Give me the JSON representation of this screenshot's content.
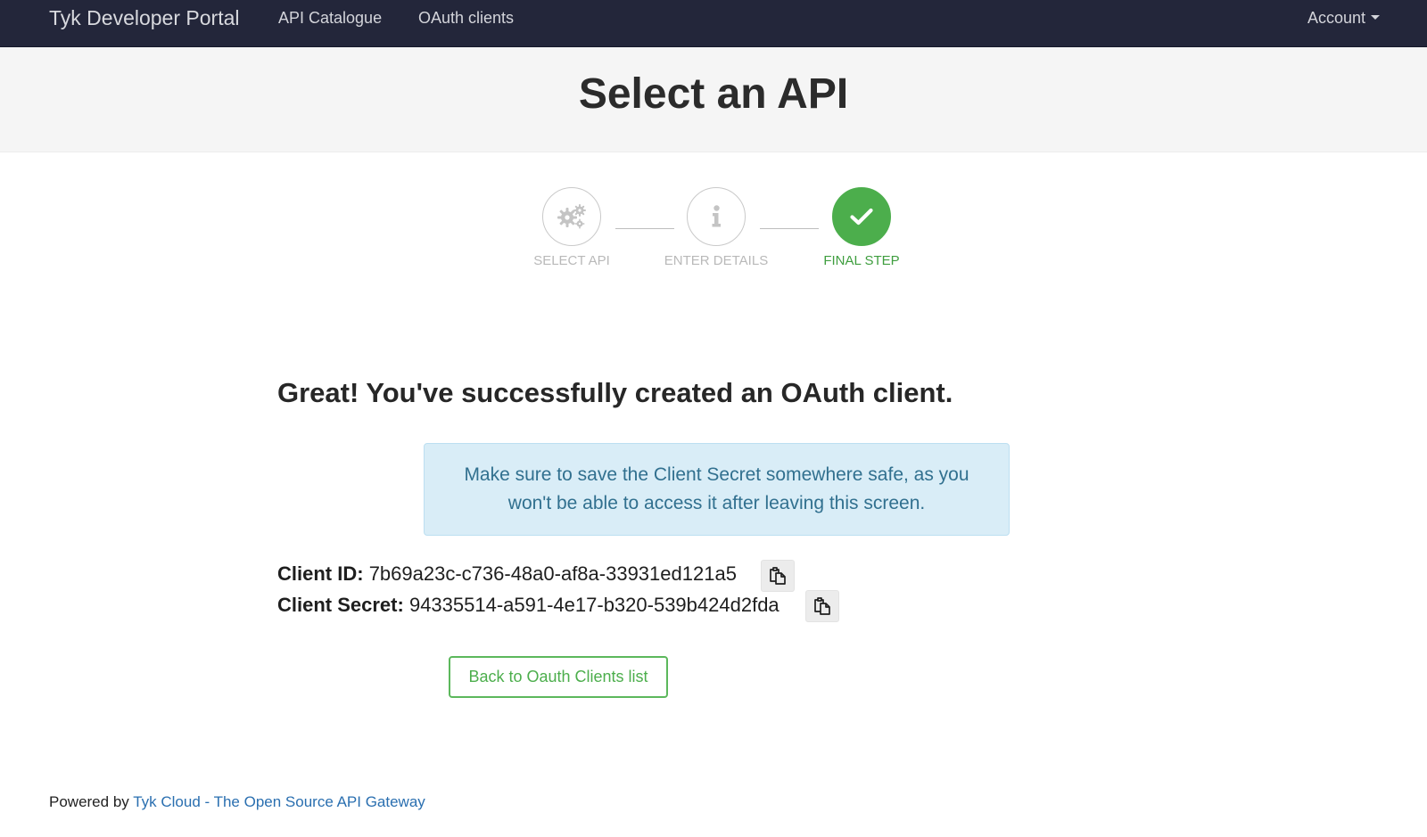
{
  "navbar": {
    "brand": "Tyk Developer Portal",
    "links": [
      {
        "label": "API Catalogue"
      },
      {
        "label": "OAuth clients"
      }
    ],
    "account_label": "Account"
  },
  "page": {
    "title": "Select an API"
  },
  "stepper": {
    "steps": [
      {
        "label": "SELECT API",
        "icon": "gears-icon",
        "state": "done-inactive"
      },
      {
        "label": "ENTER DETAILS",
        "icon": "info-icon",
        "state": "done-inactive"
      },
      {
        "label": "FINAL STEP",
        "icon": "check-icon",
        "state": "active"
      }
    ],
    "active_color": "#4cae4c"
  },
  "success": {
    "heading": "Great! You've successfully created an OAuth client.",
    "alert_line1": "Make sure to save the Client Secret somewhere safe, as you",
    "alert_line2": "won't be able to access it after leaving this screen."
  },
  "credentials": {
    "client_id_label": "Client ID:",
    "client_id_value": "7b69a23c-c736-48a0-af8a-33931ed121a5",
    "client_secret_label": "Client Secret:",
    "client_secret_value": "94335514-a591-4e17-b320-539b424d2fda",
    "copy_icon": "copy-icon"
  },
  "actions": {
    "back_label": "Back to Oauth Clients list"
  },
  "footer": {
    "prefix": "Powered by",
    "link_text": "Tyk Cloud - The Open Source API Gateway"
  },
  "colors": {
    "navbar_bg": "#23263a",
    "jumbotron_bg": "#f5f5f5",
    "success_green": "#4cae4c",
    "alert_bg": "#d9edf7",
    "alert_text": "#31708f",
    "link_blue": "#2a6fb0"
  }
}
